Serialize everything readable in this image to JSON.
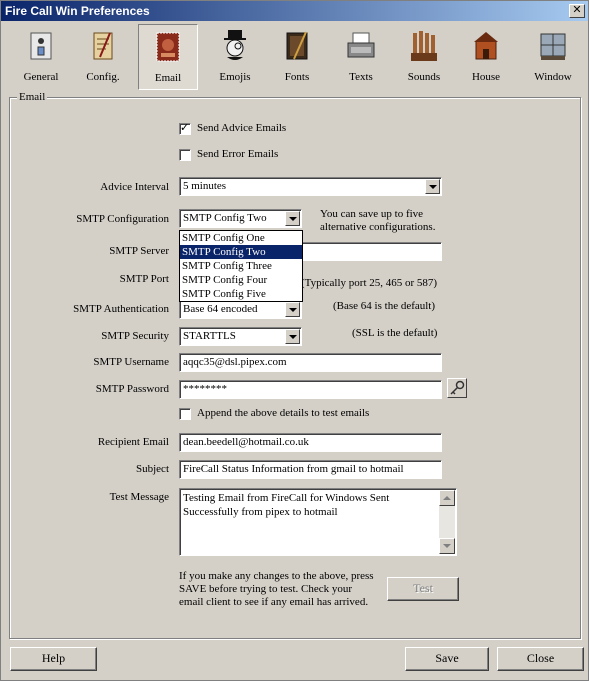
{
  "window": {
    "title": "Fire Call Win Preferences",
    "close_label": "✕"
  },
  "toolbar": [
    {
      "label": "General",
      "icon": "switch-icon"
    },
    {
      "label": "Config.",
      "icon": "scroll-icon"
    },
    {
      "label": "Email",
      "icon": "stamp-icon"
    },
    {
      "label": "Emojis",
      "icon": "monocle-man-icon"
    },
    {
      "label": "Fonts",
      "icon": "book-icon"
    },
    {
      "label": "Texts",
      "icon": "typewriter-icon"
    },
    {
      "label": "Sounds",
      "icon": "organ-icon"
    },
    {
      "label": "House",
      "icon": "house-icon"
    },
    {
      "label": "Window",
      "icon": "window-icon"
    }
  ],
  "group_label": "Email",
  "send_advice": {
    "label": "Send Advice Emails",
    "checked": true
  },
  "send_error": {
    "label": "Send Error Emails",
    "checked": false
  },
  "advice_interval": {
    "label": "Advice Interval",
    "value": "5 minutes"
  },
  "smtp_config": {
    "label": "SMTP Configuration",
    "value": "SMTP Config Two",
    "note": "You can save up to five alternative configurations.",
    "options": [
      "SMTP Config One",
      "SMTP Config Two",
      "SMTP Config Three",
      "SMTP Config Four",
      "SMTP Config Five"
    ],
    "selected_index": 1
  },
  "smtp_server": {
    "label": "SMTP Server",
    "value": ""
  },
  "smtp_port": {
    "label": "SMTP Port",
    "note": "(Typically port 25, 465 or 587)"
  },
  "smtp_auth": {
    "label": "SMTP Authentication",
    "value": "Base 64 encoded",
    "note": "(Base 64 is the default)"
  },
  "smtp_security": {
    "label": "SMTP Security",
    "value": "STARTTLS",
    "note": "(SSL is the default)"
  },
  "smtp_username": {
    "label": "SMTP Username",
    "value": "aqqc35@dsl.pipex.com"
  },
  "smtp_password": {
    "label": "SMTP Password",
    "value": "********"
  },
  "append_details": {
    "label": "Append the above details to test emails",
    "checked": false
  },
  "recipient": {
    "label": "Recipient Email",
    "value": "dean.beedell@hotmail.co.uk"
  },
  "subject": {
    "label": "Subject",
    "value": "FireCall Status Information from gmail to hotmail"
  },
  "test_message": {
    "label": "Test Message",
    "value": "Testing Email from FireCall for Windows Sent Successfully from pipex to hotmail"
  },
  "test_note": "If you make any changes to the above, press SAVE before trying to test. Check your email client to see if any email has arrived.",
  "buttons": {
    "test": "Test",
    "help": "Help",
    "save": "Save",
    "close": "Close"
  }
}
